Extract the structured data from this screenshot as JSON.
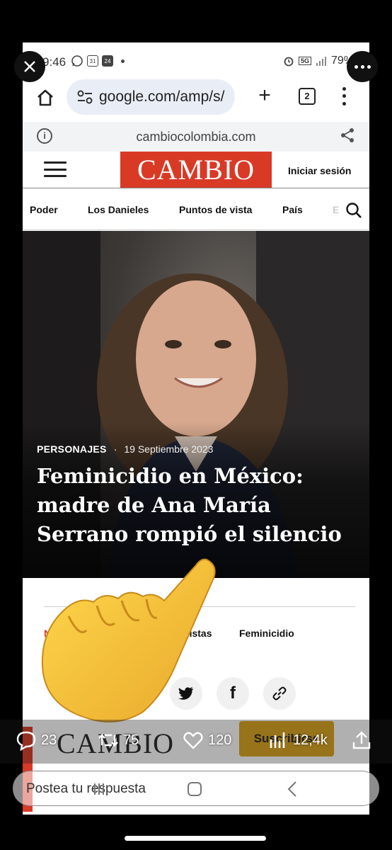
{
  "status_bar": {
    "time": "9:46",
    "calendar_day": "31",
    "badge_day": "24",
    "network": "5G",
    "battery": "79%"
  },
  "browser": {
    "url": "google.com/amp/s/",
    "tab_count": "2",
    "domain": "cambiocolombia.com"
  },
  "site": {
    "logo": "CAMBIO",
    "login": "Iniciar sesión",
    "nav": [
      "Poder",
      "Los Danieles",
      "Puntos de vista",
      "País",
      "E"
    ]
  },
  "article": {
    "category": "PERSONAJES",
    "separator": "·",
    "date": "19 Septiembre 2023",
    "title": "Feminicidio en México: madre de Ana María Serrano rompió el silencio",
    "tags": [
      "N",
      "evistas",
      "Feminicidio"
    ]
  },
  "footer": {
    "logo": "CAMBIO",
    "subscribe": "Suscribirse"
  },
  "post_actions": {
    "replies": "23",
    "reposts": "75",
    "likes": "120",
    "views": "12,4k"
  },
  "reply_placeholder": "Postea tu respuesta",
  "colors": {
    "brand_red": "#d83a26",
    "subscribe_gold": "#d9a21a"
  }
}
